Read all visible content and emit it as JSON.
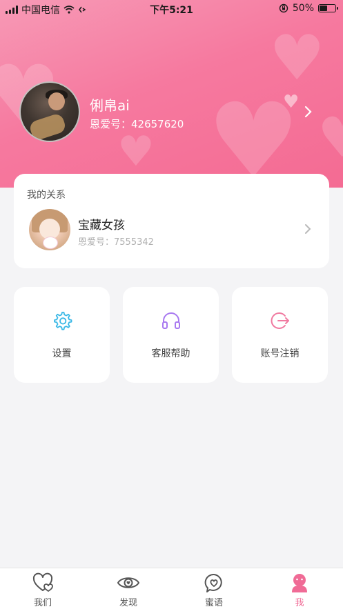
{
  "status_bar": {
    "carrier": "中国电信",
    "time": "下午5:21",
    "battery": "50%",
    "battery_level": 0.5
  },
  "profile": {
    "name": "俐帛ai",
    "id_text": "恩爱号：42657620"
  },
  "relation": {
    "title": "我的关系",
    "partner_name": "宝藏女孩",
    "partner_id_text": "恩爱号：7555342"
  },
  "actions": [
    {
      "label": "设置",
      "icon": "gear-icon",
      "color": "#39b8e6"
    },
    {
      "label": "客服帮助",
      "icon": "headset-icon",
      "color": "#a879f0"
    },
    {
      "label": "账号注销",
      "icon": "logout-icon",
      "color": "#f07aa0"
    }
  ],
  "tabs": [
    {
      "label": "我们",
      "icon": "heart-icon",
      "active": false
    },
    {
      "label": "发现",
      "icon": "eye-icon",
      "active": false
    },
    {
      "label": "蜜语",
      "icon": "heart-bubble-icon",
      "active": false
    },
    {
      "label": "我",
      "icon": "person-icon",
      "active": true
    }
  ],
  "colors": {
    "accent": "#f06b96",
    "header_gradient_start": "#f79ab6",
    "header_gradient_end": "#f46b93",
    "background": "#f4f4f6"
  }
}
